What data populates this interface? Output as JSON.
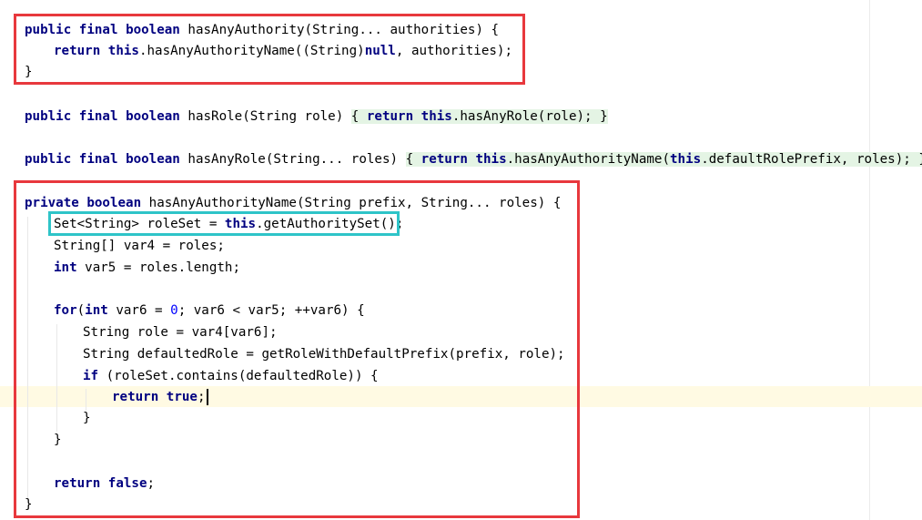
{
  "code": {
    "l1": {
      "kw1": "public",
      "kw2": "final",
      "kw3": "boolean",
      "rest": " hasAnyAuthority(String... authorities) {"
    },
    "l2": {
      "kw1": "return",
      "kw2": "this",
      "mid": ".hasAnyAuthorityName((String)",
      "kw3": "null",
      "rest": ", authorities);"
    },
    "l3": {
      "text": "}"
    },
    "l4": {
      "kw1": "public",
      "kw2": "final",
      "kw3": "boolean",
      "mid": " hasRole(String role) ",
      "b1": "{",
      "kw4": "return",
      "kw5": "this",
      "rest": ".hasAnyRole(role);",
      "b2": "}"
    },
    "l5": {
      "kw1": "public",
      "kw2": "final",
      "kw3": "boolean",
      "mid": " hasAnyRole(String... roles) ",
      "b1": "{",
      "kw4": "return",
      "kw5": "this",
      "mid2": ".hasAnyAuthorityName(",
      "kw6": "this",
      "rest": ".defaultRolePrefix, roles);",
      "b2": "}"
    },
    "l6": {
      "kw1": "private",
      "kw2": "boolean",
      "rest": " hasAnyAuthorityName(String prefix, String... roles) {"
    },
    "l7": {
      "pre": "Set<String> roleSet = ",
      "kw1": "this",
      "rest": ".getAuthoritySet();"
    },
    "l8": {
      "text": "String[] var4 = roles;"
    },
    "l9": {
      "kw1": "int",
      "rest": " var5 = roles.length;"
    },
    "l10": {
      "kw1": "for",
      "pre": "(",
      "kw2": "int",
      "mid": " var6 = ",
      "num": "0",
      "rest": "; var6 < var5; ++var6) {"
    },
    "l11": {
      "text": "String role = var4[var6];"
    },
    "l12": {
      "text": "String defaultedRole = getRoleWithDefaultPrefix(prefix, role);"
    },
    "l13": {
      "kw1": "if",
      "rest": " (roleSet.contains(defaultedRole)) {"
    },
    "l14": {
      "kw1": "return",
      "kw2": "true",
      "rest": ";"
    },
    "l15": {
      "text": "}"
    },
    "l16": {
      "text": "}"
    },
    "l17": {
      "kw1": "return",
      "kw2": "false",
      "rest": ";"
    },
    "l18": {
      "text": "}"
    }
  },
  "colors": {
    "keyword": "#000080",
    "number": "#0000ff",
    "highlight_red": "#e8383d",
    "highlight_cyan": "#2ec4c8",
    "caret_line": "#fffae3"
  }
}
